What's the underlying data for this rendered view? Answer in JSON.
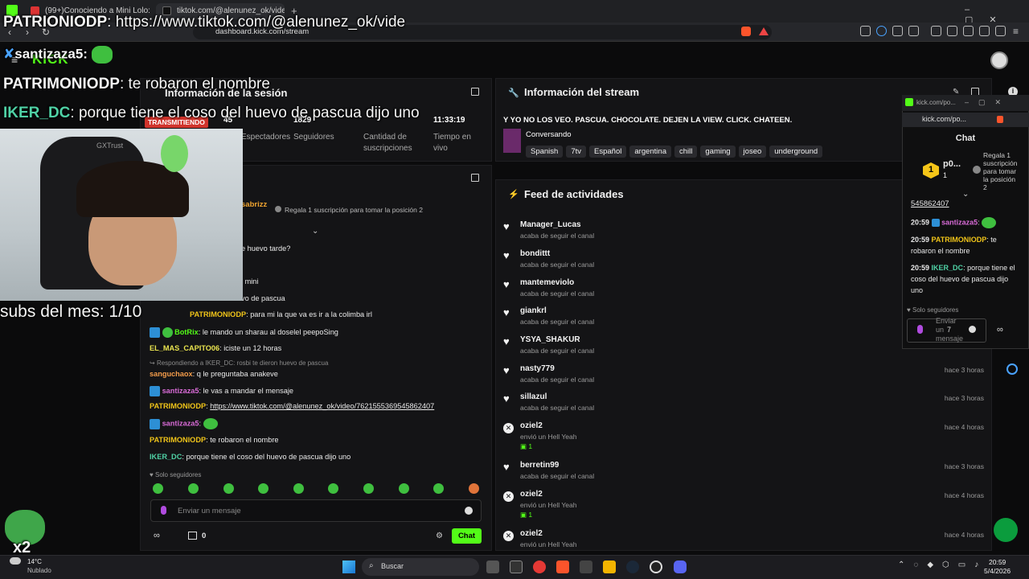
{
  "browser": {
    "tab1": "(99+)Conociendo a Mini Lolo: Su Es",
    "tab2": "tiktok.com/@alenunez_ok/video/762",
    "url": "dashboard.kick.com/stream",
    "new_tab": "+"
  },
  "overlay": {
    "line1_user": "PATRIONIODP",
    "line1_text": ": https://www.tiktok.com/@alenunez_ok/vide",
    "line2_user": "santizaza5:",
    "line3_user": "PATRIMONIODP",
    "line3_text": ": te robaron el nombre",
    "line4_user": "IKER_DC",
    "line4_text": ": porque tiene el coso del huevo de pascua dijo uno",
    "subs": "subs del mes: 1/10",
    "combo": "x2",
    "kick_logo": "KICK"
  },
  "session_panel": {
    "title": "Información de la sesión",
    "status_badge": "TRANSMITIENDO",
    "viewers_value": "45",
    "viewers_label": "Espectadores",
    "followers_value": "1829",
    "followers_label": "Seguidores",
    "subs_value": "",
    "subs_label": "Cantidad de suscripciones",
    "time_value": "11:33:19",
    "time_label": "Tiempo en vivo",
    "partial_label": "Clasificación"
  },
  "chat_panel": {
    "top_user": "sabrizz",
    "gift_text": "Regala 1 suscripción para tomar la posición 2",
    "messages": [
      {
        "user": "",
        "text": "e huevo tarde?"
      },
      {
        "user": "",
        "text": "l mini"
      },
      {
        "user": "",
        "text": "vo de pascua"
      },
      {
        "user": "PATRIMONIODP",
        "text": ": para mi la que va es ir a la colimba irl"
      },
      {
        "user": "BotRix",
        "text": ": le mando un sharau al doselel peepoSing"
      },
      {
        "user": "EL_MAS_CAPITO06",
        "text": ": iciste un 12 horas"
      },
      {
        "user": "",
        "text": "Respondiendo a IKER_DC: rosbi te dieron huevo de pascua"
      },
      {
        "user": "sanguchaox",
        "text": ": q le preguntaba anakeve"
      },
      {
        "user": "santizaza5",
        "text": ": le vas a mandar el mensaje"
      },
      {
        "user": "PATRIMONIODP",
        "text": ": "
      },
      {
        "user": "santizaza5",
        "text": ":"
      },
      {
        "user": "PATRIMONIODP",
        "text": ": te robaron el nombre"
      },
      {
        "user": "IKER_DC",
        "text": ": porque tiene el coso del huevo de pascua dijo uno"
      }
    ],
    "link": "https://www.tiktok.com/@alenunez_ok/video/7621555369545862407",
    "followers_only": "Solo seguidores",
    "input_placeholder": "Enviar un mensaje",
    "points": "0",
    "chat_button": "Chat"
  },
  "stream_info": {
    "title": "Información del stream",
    "stream_title": "Y YO NO LOS VEO. PASCUA. CHOCOLATE. DEJEN LA VIEW. CLICK. CHATEEN.",
    "category": "Conversando",
    "tags": [
      "Spanish",
      "7tv",
      "Español",
      "argentina",
      "chill",
      "gaming",
      "joseo",
      "underground"
    ]
  },
  "activity_feed": {
    "title": "Feed de actividades",
    "items": [
      {
        "user": "Manager_Lucas",
        "action": "acaba de seguir el canal",
        "time": "",
        "kind": "follow"
      },
      {
        "user": "bondittt",
        "action": "acaba de seguir el canal",
        "time": "",
        "kind": "follow"
      },
      {
        "user": "mantemeviolo",
        "action": "acaba de seguir el canal",
        "time": "",
        "kind": "follow"
      },
      {
        "user": "giankrl",
        "action": "acaba de seguir el canal",
        "time": "",
        "kind": "follow"
      },
      {
        "user": "YSYA_SHAKUR",
        "action": "acaba de seguir el canal",
        "time": "",
        "kind": "follow"
      },
      {
        "user": "nasty779",
        "action": "acaba de seguir el canal",
        "time": "hace 3 horas",
        "kind": "follow"
      },
      {
        "user": "sillazul",
        "action": "acaba de seguir el canal",
        "time": "hace 3 horas",
        "kind": "follow"
      },
      {
        "user": "oziel2",
        "action": "envió un Hell Yeah",
        "time": "hace 4 horas",
        "kind": "gift",
        "count": "1"
      },
      {
        "user": "berretin99",
        "action": "acaba de seguir el canal",
        "time": "hace 3 horas",
        "kind": "follow"
      },
      {
        "user": "oziel2",
        "action": "envió un Hell Yeah",
        "time": "hace 4 horas",
        "kind": "gift",
        "count": "1"
      },
      {
        "user": "oziel2",
        "action": "envió un Hell Yeah",
        "time": "hace 4 horas",
        "kind": "gift",
        "count": ""
      }
    ]
  },
  "popup_chat": {
    "url": "kick.com/po...",
    "title": "Chat",
    "leader_name": "p0...",
    "leader_count": "1",
    "gift_text": "Regala 1 suscripción para tomar la posición 2",
    "link_tail": "545862407",
    "messages": [
      {
        "time": "20:59",
        "user": "santizaza5",
        "text": ":"
      },
      {
        "time": "20:59",
        "user": "PATRIMONIODP",
        "text": ": te robaron el nombre"
      },
      {
        "time": "20:59",
        "user": "IKER_DC",
        "text": ": porque tiene el coso del huevo de pascua dijo uno"
      }
    ],
    "followers_only": "Solo seguidores",
    "input_placeholder": "Enviar un mensaje"
  },
  "taskbar": {
    "temp": "14°C",
    "weather": "Nublado",
    "search": "Buscar",
    "time": "20:59",
    "date": "5/4/2026"
  }
}
